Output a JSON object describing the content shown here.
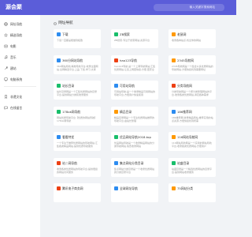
{
  "header": {
    "logo": "源会聚",
    "search_placeholder": "输入关键字搜索网站"
  },
  "sidebar": {
    "items": [
      {
        "label": "网址导航",
        "icon": "globe-icon"
      },
      {
        "label": "精选导航",
        "icon": "star-icon"
      },
      {
        "label": "电影",
        "icon": "film-icon"
      },
      {
        "label": "音乐",
        "icon": "music-icon"
      },
      {
        "label": "建站",
        "icon": "tool-icon"
      },
      {
        "label": "电脑系统",
        "icon": "computer-icon"
      }
    ],
    "bottom_items": [
      {
        "label": "非遗文化",
        "icon": "bookmark-icon"
      },
      {
        "label": "在线留言",
        "icon": "chat-icon"
      }
    ]
  },
  "section": {
    "title": "网址导航"
  },
  "cards": [
    {
      "name": "下载",
      "desc": "下载一直都是能做到极致",
      "color": "#2d8cf0"
    },
    {
      "name": "ZB搜索",
      "desc": "ZB搜索,专注于搜索网站,资源平台",
      "color": "#19be6b"
    },
    {
      "name": "老鼠网",
      "desc": "收录各种站点,找全你的网站",
      "color": "#ff9900"
    },
    {
      "name": "360分网站导航",
      "desc": "360网站导航,精准导航平台,收录全面网站,全网精选平台,上品,下载,学习,文库",
      "color": "#2d8cf0"
    },
    {
      "name": "hao123导航",
      "desc": "hao123导航,是一个上网导航网站,汇集优质网站,让您上网更快捷,方便,更安全",
      "color": "#ed4014"
    },
    {
      "name": "2345导航网",
      "desc": "2345导航网是一个集合众多优质网站的导航网站,方便快捷找到需要网址",
      "color": "#ff9900"
    },
    {
      "name": "站长目录",
      "desc": "站长目录网是一个汇集优质网站的目录平台,提供网站分类和收录服务",
      "color": "#19be6b"
    },
    {
      "name": "可用站导航",
      "desc": "可用站导航,是一个收录精品可用网站的导航平台,方便用户快速使用",
      "color": "#2d8cf0"
    },
    {
      "name": "分类导航网",
      "desc": "分类导航网是一个按分类整理网站的平台,收录各类优质网站,满足各种需求",
      "color": "#ed4014"
    },
    {
      "name": "178ok网导航",
      "desc": "网站优质导航平台【优质的网站导航】178ok网导航",
      "color": "#19be6b"
    },
    {
      "name": "精品目录",
      "desc": "精品目录网是一个专注优质网站推荐的导航平台,由站长整理",
      "color": "#ff9900"
    },
    {
      "name": "186推荐网",
      "desc": "186推荐网,收录精品网站,推荐实用的站点资源,方便快捷找到所需",
      "color": "#2d8cf0"
    },
    {
      "name": "看看特优",
      "desc": "一个专注于推荐优质网站的导航网站,汇集各类精品网站,提供优质导航服务",
      "color": "#2d8cf0"
    },
    {
      "name": "优品网站导航2018.top",
      "desc": "优品网站导航是一个收录精品网站的分类导航网站,免费收录网站",
      "color": "#19be6b"
    },
    {
      "name": "116网站导航网",
      "desc": "116网站导航网是一个实用的网站导航平台,收录各类优质网站,方便用户",
      "color": "#ff9900"
    },
    {
      "name": "站二网导航",
      "desc": "收录各类优质网站的导航平台,提供便捷的网站访问服务",
      "color": "#ed4014"
    },
    {
      "name": "集点网站分类目录",
      "desc": "集点网站分类目录是一个收录优质网站的分类目录平台",
      "color": "#2d8cf0"
    },
    {
      "name": "站盛目录",
      "desc": "站盛目录是一个精选优质网站的目录平台,提供网站收录服务",
      "color": "#19be6b"
    },
    {
      "name": "腾讯电子商务网",
      "desc": "",
      "color": "#ed4014"
    },
    {
      "name": "全球网址导航",
      "desc": "",
      "color": "#2d8cf0"
    },
    {
      "name": "75网站分类",
      "desc": "",
      "color": "#ff9900"
    }
  ]
}
